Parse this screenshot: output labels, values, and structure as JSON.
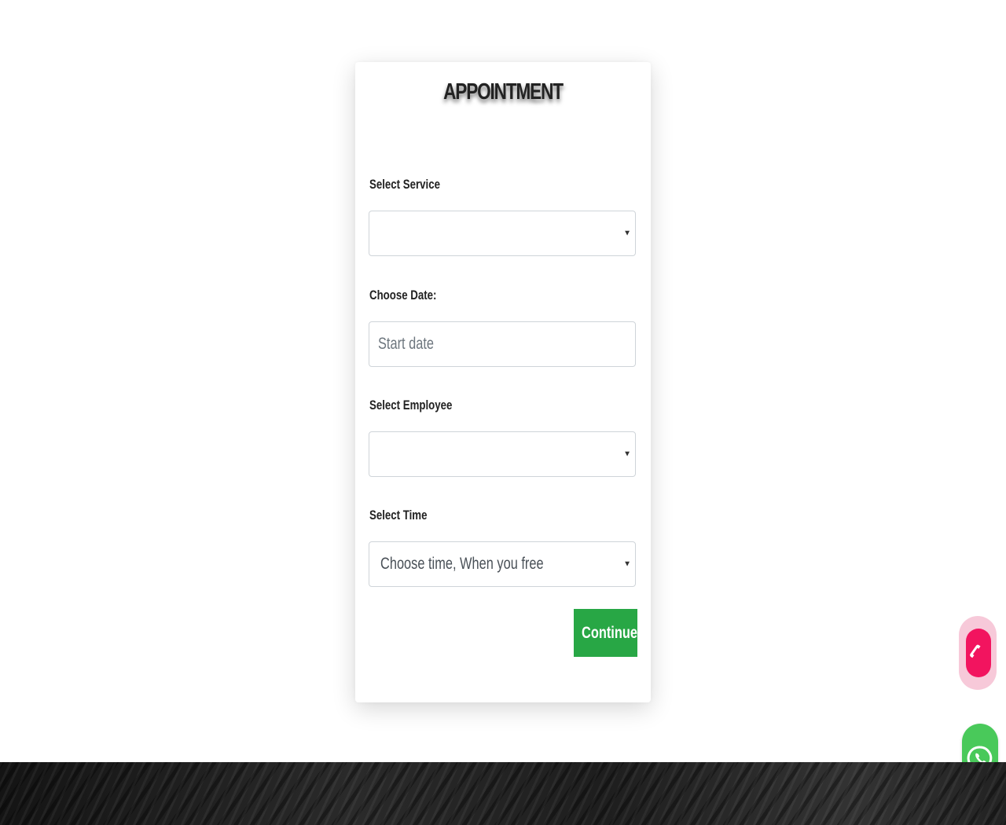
{
  "form": {
    "title": "APPOINTMENT",
    "service": {
      "label": "Select Service",
      "value": ""
    },
    "date": {
      "label": "Choose Date:",
      "placeholder": "Start date",
      "value": ""
    },
    "employee": {
      "label": "Select Employee",
      "value": ""
    },
    "time": {
      "label": "Select Time",
      "value": "Choose time, When you free"
    },
    "submit_label": "Continue"
  },
  "floating": {
    "phone_icon": "phone-icon",
    "whatsapp_icon": "whatsapp-icon"
  },
  "colors": {
    "submit_button": "#28a745",
    "phone_button": "#f2145f",
    "whatsapp_button": "#49c95a"
  }
}
